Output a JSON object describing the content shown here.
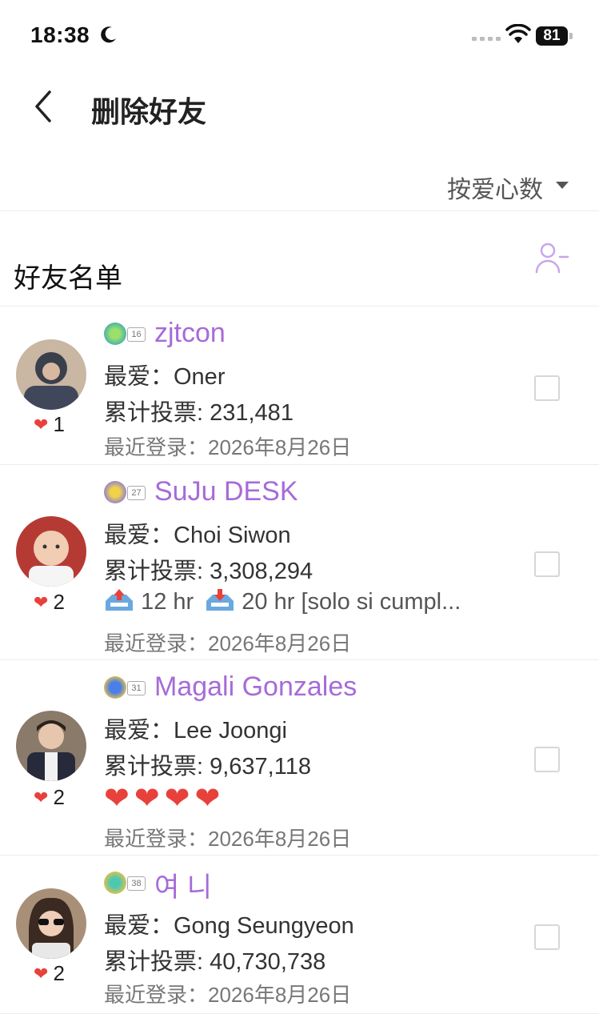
{
  "status": {
    "time": "18:38",
    "battery": "81"
  },
  "nav": {
    "title": "删除好友"
  },
  "sort": {
    "label": "按爱心数"
  },
  "list": {
    "title": "好友名单"
  },
  "friends": [
    {
      "name": "zjtcon",
      "level": "16",
      "hearts": "1",
      "favorite": "最爱：Oner",
      "votes": "累计投票: 231,481",
      "status": "",
      "last_login": "最近登录：2026年8月26日"
    },
    {
      "name": "SuJu DESK",
      "level": "27",
      "hearts": "2",
      "favorite": "最爱：Choi Siwon",
      "votes": "累计投票: 3,308,294",
      "status_up": "12 hr",
      "status_down": "20 hr [solo si cumpl...",
      "last_login": "最近登录：2026年8月26日"
    },
    {
      "name": "Magali Gonzales",
      "level": "31",
      "hearts": "2",
      "favorite": "最爱：Lee Joongi",
      "votes": "累计投票: 9,637,118",
      "status": "❤❤❤❤",
      "last_login": "最近登录：2026年8月26日"
    },
    {
      "name": "여 니",
      "level": "38",
      "hearts": "2",
      "favorite": "最爱：Gong Seungyeon",
      "votes": "累计投票: 40,730,738",
      "status": "",
      "last_login": "最近登录：2026年8月26日"
    }
  ],
  "colors": {
    "accent": "#a66bd8",
    "heart": "#e8413b"
  }
}
